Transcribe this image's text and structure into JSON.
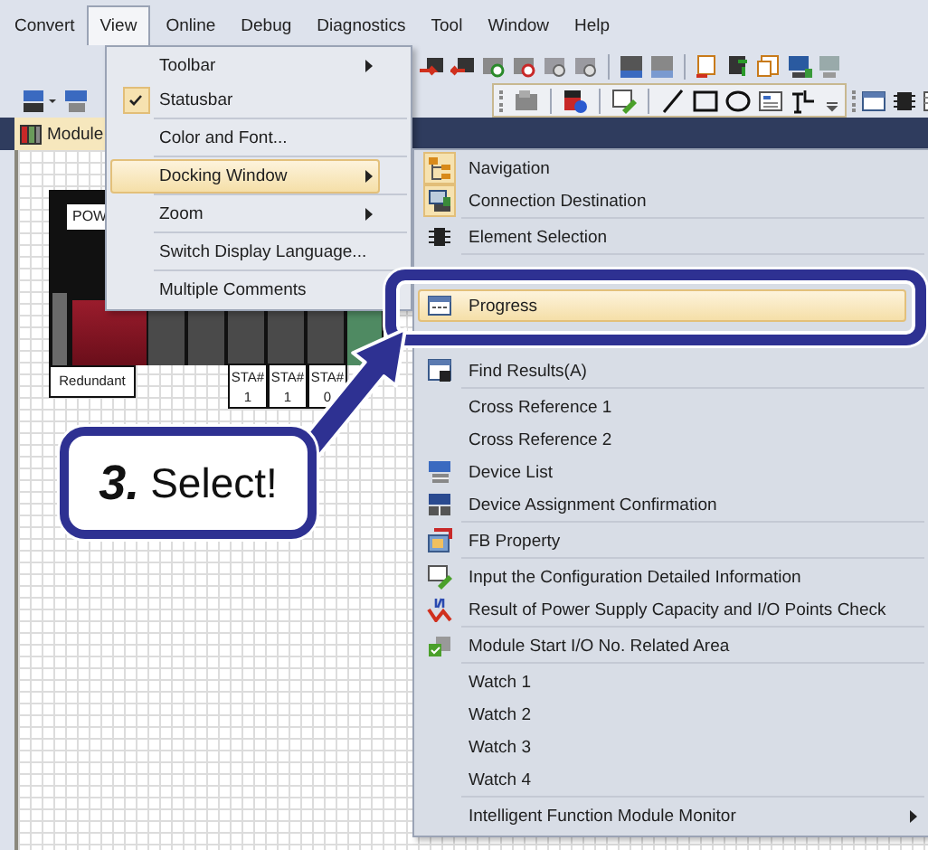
{
  "menubar": [
    {
      "label": "Convert",
      "selected": false
    },
    {
      "label": "View",
      "selected": true
    },
    {
      "label": "Online",
      "selected": false
    },
    {
      "label": "Debug",
      "selected": false
    },
    {
      "label": "Diagnostics",
      "selected": false
    },
    {
      "label": "Tool",
      "selected": false
    },
    {
      "label": "Window",
      "selected": false
    },
    {
      "label": "Help",
      "selected": false
    }
  ],
  "document_tab": {
    "label": "Module",
    "selected": true
  },
  "module_configuration": {
    "header": "POW",
    "redundant_label": "Redundant",
    "stations": [
      {
        "label": "STA#",
        "number": "1"
      },
      {
        "label": "STA#",
        "number": "1"
      },
      {
        "label": "STA#",
        "number": "0"
      }
    ]
  },
  "view_menu": {
    "groups": [
      {
        "items": [
          {
            "label": "Toolbar",
            "kind": "submenu",
            "checked": false,
            "selected": false
          },
          {
            "label": "Statusbar",
            "kind": "command",
            "checked": true,
            "selected": false
          }
        ]
      },
      {
        "items": [
          {
            "label": "Color and Font...",
            "kind": "command",
            "checked": false,
            "selected": false
          }
        ]
      },
      {
        "items": [
          {
            "label": "Docking Window",
            "kind": "submenu",
            "checked": false,
            "selected": true
          }
        ]
      },
      {
        "items": [
          {
            "label": "Zoom",
            "kind": "submenu",
            "checked": false,
            "selected": false
          }
        ]
      },
      {
        "items": [
          {
            "label": "Switch Display Language...",
            "kind": "command",
            "checked": false,
            "selected": false
          }
        ]
      },
      {
        "items": [
          {
            "label": "Multiple Comments",
            "kind": "command",
            "checked": false,
            "selected": false
          }
        ]
      }
    ]
  },
  "docking_window_submenu": {
    "groups": [
      {
        "items": [
          {
            "label": "Navigation",
            "kind": "command",
            "checked": true,
            "selected": false
          },
          {
            "label": "Connection Destination",
            "kind": "command",
            "checked": true,
            "selected": false
          }
        ]
      },
      {
        "items": [
          {
            "label": "Element Selection",
            "kind": "command",
            "checked": false,
            "selected": false
          }
        ]
      },
      {
        "items": [
          {
            "label": "Progress",
            "kind": "command",
            "checked": false,
            "selected": true
          },
          {
            "label": "Find Results(A)",
            "kind": "command",
            "checked": false,
            "selected": false
          }
        ]
      },
      {
        "items": [
          {
            "label": "Cross Reference 1",
            "kind": "command",
            "checked": false,
            "selected": false
          },
          {
            "label": "Cross Reference 2",
            "kind": "command",
            "checked": false,
            "selected": false
          },
          {
            "label": "Device List",
            "kind": "command",
            "checked": false,
            "selected": false
          },
          {
            "label": "Device Assignment Confirmation",
            "kind": "command",
            "checked": false,
            "selected": false
          }
        ]
      },
      {
        "items": [
          {
            "label": "FB Property",
            "kind": "command",
            "checked": false,
            "selected": false
          }
        ]
      },
      {
        "items": [
          {
            "label": "Input the Configuration Detailed Information",
            "kind": "command",
            "checked": false,
            "selected": false
          },
          {
            "label": "Result of Power Supply Capacity and I/O Points Check",
            "kind": "command",
            "checked": false,
            "selected": false
          }
        ]
      },
      {
        "items": [
          {
            "label": "Module Start I/O No. Related Area",
            "kind": "command",
            "checked": false,
            "selected": false
          }
        ]
      },
      {
        "items": [
          {
            "label": "Watch 1",
            "kind": "command",
            "checked": false,
            "selected": false
          },
          {
            "label": "Watch 2",
            "kind": "command",
            "checked": false,
            "selected": false
          },
          {
            "label": "Watch 3",
            "kind": "command",
            "checked": false,
            "selected": false
          },
          {
            "label": "Watch 4",
            "kind": "command",
            "checked": false,
            "selected": false
          }
        ]
      },
      {
        "items": [
          {
            "label": "Intelligent Function Module Monitor",
            "kind": "submenu",
            "checked": false,
            "selected": false
          }
        ]
      }
    ]
  },
  "callout": {
    "step": "3.",
    "text": "Select!"
  }
}
